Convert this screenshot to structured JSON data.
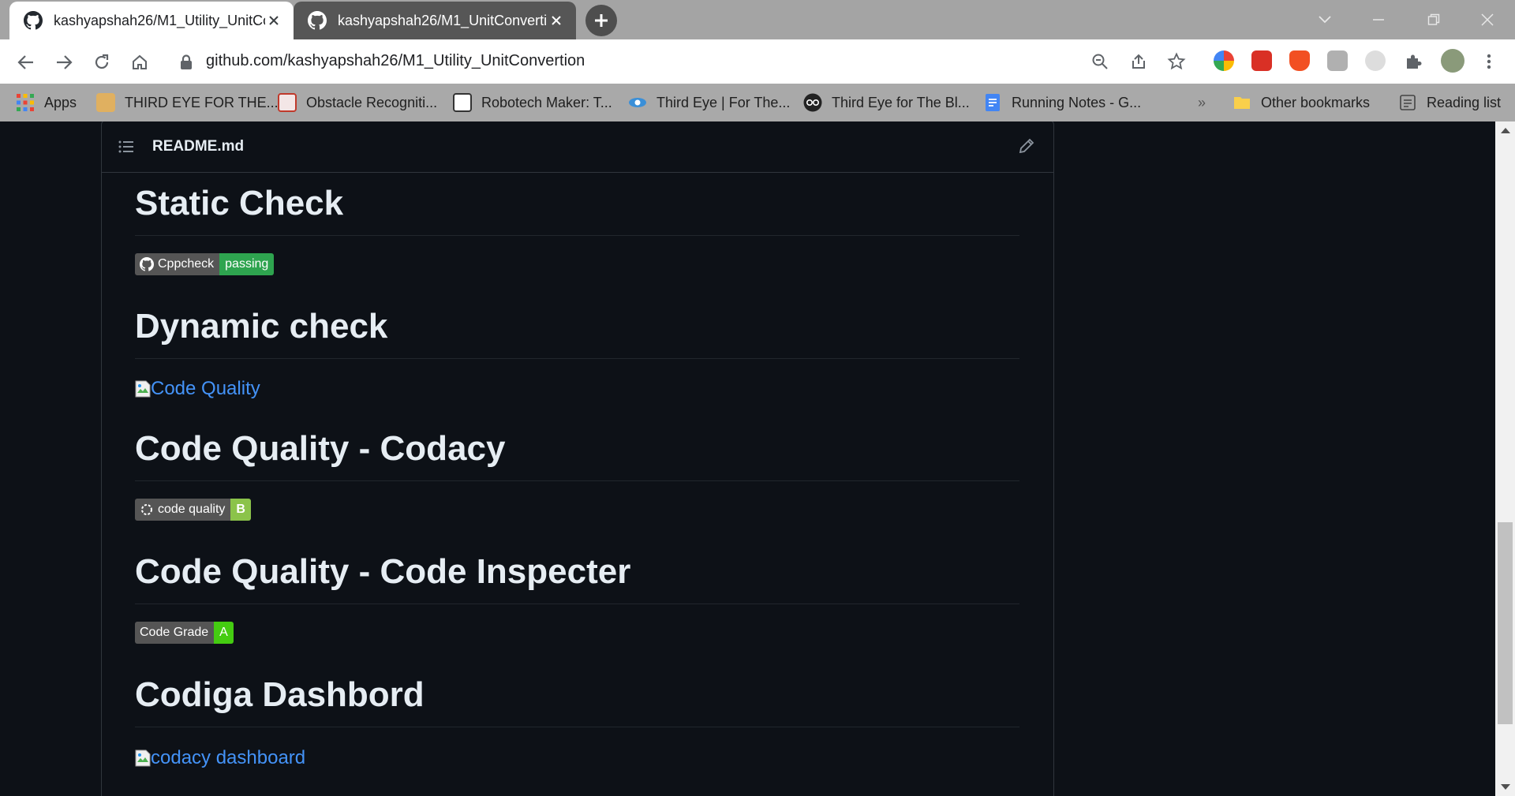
{
  "tabs": [
    {
      "title": "kashyapshah26/M1_Utility_UnitCo",
      "active": true
    },
    {
      "title": "kashyapshah26/M1_UnitConverti",
      "active": false
    }
  ],
  "address_bar": {
    "url": "github.com/kashyapshah26/M1_Utility_UnitConvertion"
  },
  "bookmarks": [
    {
      "label": "Apps",
      "icon": "apps-grid-icon"
    },
    {
      "label": "THIRD EYE FOR THE...",
      "icon": "bookmark-favicon"
    },
    {
      "label": "Obstacle Recogniti...",
      "icon": "bookmark-favicon"
    },
    {
      "label": "Robotech Maker: T...",
      "icon": "bookmark-favicon"
    },
    {
      "label": "Third Eye | For The...",
      "icon": "eye-icon"
    },
    {
      "label": "Third Eye for The Bl...",
      "icon": "glasses-icon"
    },
    {
      "label": "Running Notes - G...",
      "icon": "docs-icon"
    }
  ],
  "bookmarks_overflow": "»",
  "other_bookmarks": "Other bookmarks",
  "reading_list": "Reading list",
  "readme": {
    "filename": "README.md",
    "sections": [
      {
        "heading": "Static Check",
        "badge": {
          "left": "Cppcheck",
          "right": "passing",
          "right_color": "#2ea44f"
        }
      },
      {
        "heading": "Dynamic check",
        "broken_image_alt": "Code Quality"
      },
      {
        "heading": "Code Quality - Codacy",
        "badge": {
          "left": "code quality",
          "right": "B",
          "right_color": "#8bc34a"
        }
      },
      {
        "heading": "Code Quality - Code Inspecter",
        "badge": {
          "left": "Code Grade",
          "right": "A",
          "right_color": "#44cc11"
        }
      },
      {
        "heading": "Codiga Dashbord",
        "broken_image_alt": "codacy dashboard"
      }
    ]
  },
  "colors": {
    "page_bg": "#0d1117",
    "link": "#4493f8",
    "heading": "#e6edf3"
  }
}
